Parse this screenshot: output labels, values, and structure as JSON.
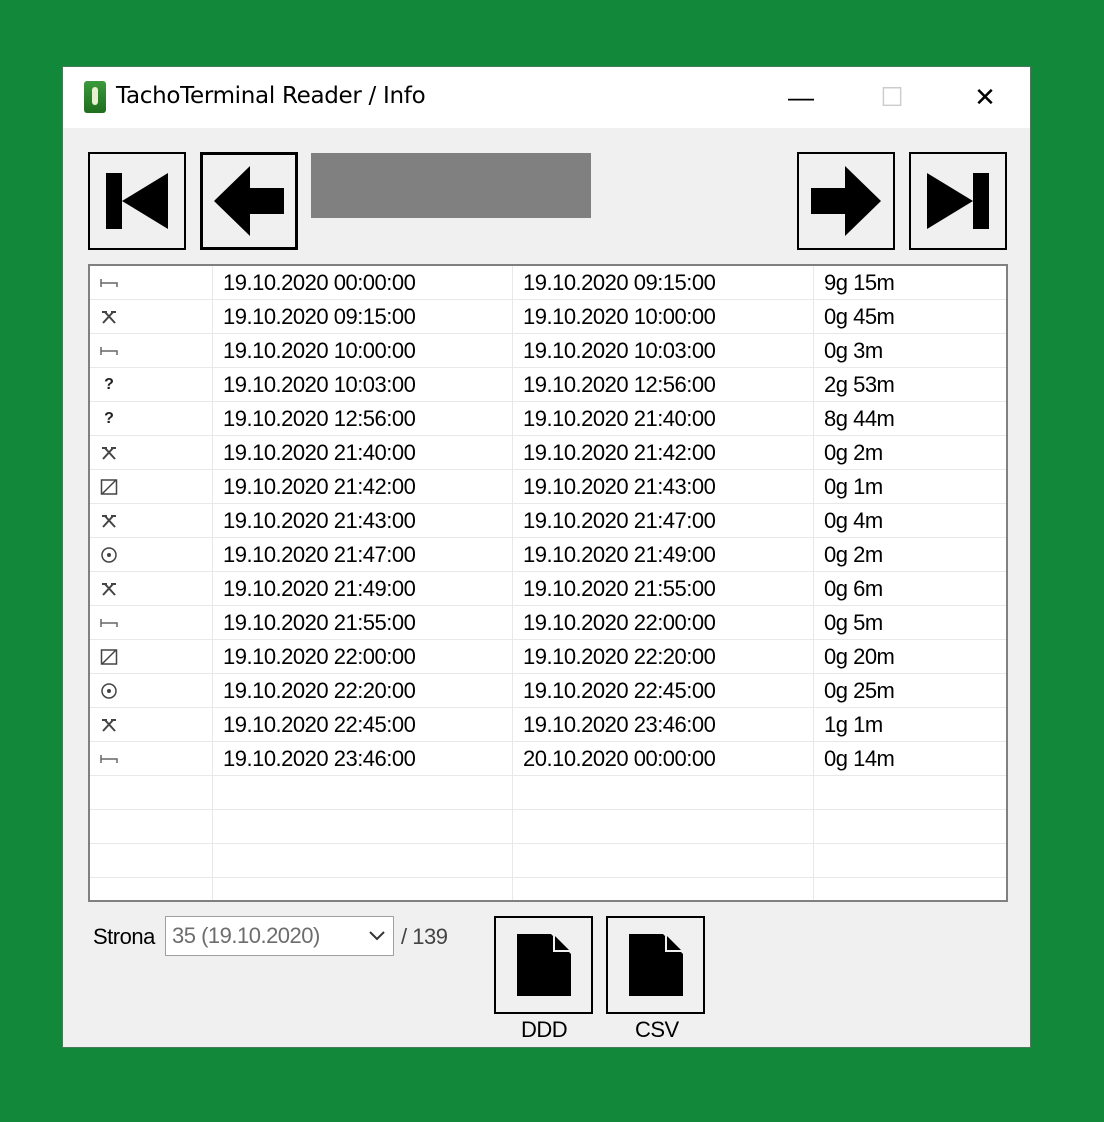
{
  "window": {
    "title": "TachoTerminal Reader / Info",
    "minimize": "—",
    "maximize": "☐",
    "close": "✕"
  },
  "nav": {
    "first": "first-page",
    "prev": "previous-page",
    "next": "next-page",
    "last": "last-page"
  },
  "table": {
    "rows": [
      {
        "icon": "rest",
        "start": "19.10.2020 00:00:00",
        "end": "19.10.2020 09:15:00",
        "duration": "9g 15m"
      },
      {
        "icon": "work",
        "start": "19.10.2020 09:15:00",
        "end": "19.10.2020 10:00:00",
        "duration": "0g 45m"
      },
      {
        "icon": "rest",
        "start": "19.10.2020 10:00:00",
        "end": "19.10.2020 10:03:00",
        "duration": "0g 3m"
      },
      {
        "icon": "unknown",
        "start": "19.10.2020 10:03:00",
        "end": "19.10.2020 12:56:00",
        "duration": "2g 53m"
      },
      {
        "icon": "unknown",
        "start": "19.10.2020 12:56:00",
        "end": "19.10.2020 21:40:00",
        "duration": "8g 44m"
      },
      {
        "icon": "work",
        "start": "19.10.2020 21:40:00",
        "end": "19.10.2020 21:42:00",
        "duration": "0g 2m"
      },
      {
        "icon": "availability",
        "start": "19.10.2020 21:42:00",
        "end": "19.10.2020 21:43:00",
        "duration": "0g 1m"
      },
      {
        "icon": "work",
        "start": "19.10.2020 21:43:00",
        "end": "19.10.2020 21:47:00",
        "duration": "0g 4m"
      },
      {
        "icon": "driving",
        "start": "19.10.2020 21:47:00",
        "end": "19.10.2020 21:49:00",
        "duration": "0g 2m"
      },
      {
        "icon": "work",
        "start": "19.10.2020 21:49:00",
        "end": "19.10.2020 21:55:00",
        "duration": "0g 6m"
      },
      {
        "icon": "rest",
        "start": "19.10.2020 21:55:00",
        "end": "19.10.2020 22:00:00",
        "duration": "0g 5m"
      },
      {
        "icon": "availability",
        "start": "19.10.2020 22:00:00",
        "end": "19.10.2020 22:20:00",
        "duration": "0g 20m"
      },
      {
        "icon": "driving",
        "start": "19.10.2020 22:20:00",
        "end": "19.10.2020 22:45:00",
        "duration": "0g 25m"
      },
      {
        "icon": "work",
        "start": "19.10.2020 22:45:00",
        "end": "19.10.2020 23:46:00",
        "duration": "1g 1m"
      },
      {
        "icon": "rest",
        "start": "19.10.2020 23:46:00",
        "end": "20.10.2020 00:00:00",
        "duration": "0g 14m"
      }
    ]
  },
  "footer": {
    "page_label": "Strona",
    "page_value": "35 (19.10.2020)",
    "page_total": "/ 139",
    "ddd_label": "DDD",
    "csv_label": "CSV"
  }
}
